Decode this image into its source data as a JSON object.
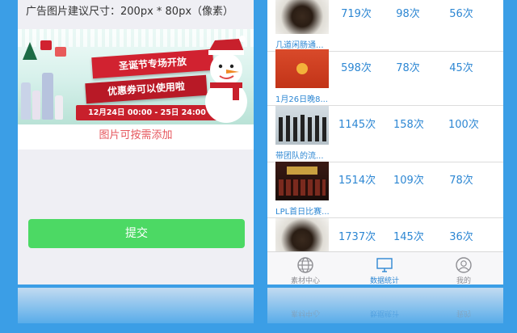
{
  "left_panel": {
    "ad_hint": "广告图片建议尺寸：200px * 80px（像素）",
    "banner": {
      "line1": "圣诞节专场开放",
      "line2": "优惠券可以使用啦",
      "dates": "12月24日 00:00 - 25日 24:00"
    },
    "add_note": "图片可按需添加",
    "submit_label": "提交"
  },
  "right_panel": {
    "rows": [
      {
        "title": "几道闲肠通...",
        "c1": "719次",
        "c2": "98次",
        "c3": "56次",
        "thumb": "food"
      },
      {
        "title": "1月26日晚8...",
        "c1": "598次",
        "c2": "78次",
        "c3": "45次",
        "thumb": "red-envelope"
      },
      {
        "title": "带团队的流...",
        "c1": "1145次",
        "c2": "158次",
        "c3": "100次",
        "thumb": "group"
      },
      {
        "title": "LPL首日比赛...",
        "c1": "1514次",
        "c2": "109次",
        "c3": "78次",
        "thumb": "event"
      },
      {
        "title": "",
        "c1": "1737次",
        "c2": "145次",
        "c3": "36次",
        "thumb": "food"
      }
    ],
    "tabs": [
      {
        "label": "素材中心",
        "icon": "globe-icon",
        "active": false
      },
      {
        "label": "数据统计",
        "icon": "monitor-icon",
        "active": true
      },
      {
        "label": "我的",
        "icon": "user-icon",
        "active": false
      }
    ]
  },
  "colors": {
    "background": "#3b9ee6",
    "accent_blue": "#2d87d3",
    "submit_green": "#4cd964",
    "note_red": "#e6565c"
  }
}
